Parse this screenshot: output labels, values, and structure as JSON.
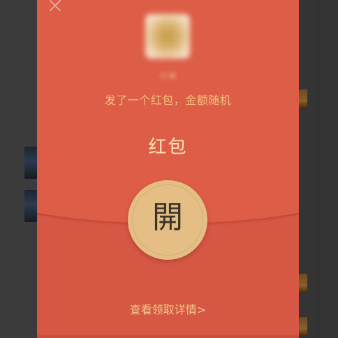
{
  "envelope": {
    "sender_name": "小米",
    "subtitle": "发了一个红包，金额随机",
    "title": "红包",
    "open_label": "開",
    "details_link": "查看领取详情>"
  },
  "icons": {
    "close": "close-icon"
  },
  "colors": {
    "envelope_red": "#d55744",
    "envelope_top": "#dd5d47",
    "open_button": "#e4be84",
    "title_text": "#fbe2b7",
    "subtitle_text": "#f1c37f",
    "link_text": "#f4c889",
    "overlay_background": "#3b3b3b"
  }
}
